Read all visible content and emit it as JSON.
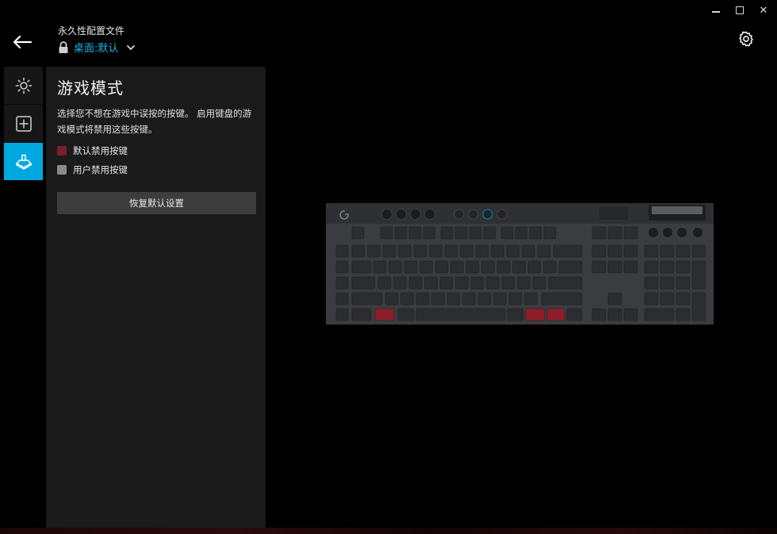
{
  "window": {
    "minimize_icon": "minimize-icon",
    "maximize_icon": "maximize-icon",
    "close_glyph": "✕"
  },
  "header": {
    "profile_label": "永久性配置文件",
    "profile_value": "桌面:默认",
    "back_icon": "arrow-left-icon",
    "settings_icon": "gear-icon"
  },
  "rail": {
    "items": [
      {
        "icon": "lighting-sun-icon",
        "active": false
      },
      {
        "icon": "add-assignment-icon",
        "active": false
      },
      {
        "icon": "game-mode-joystick-icon",
        "active": true
      }
    ]
  },
  "panel": {
    "title": "游戏模式",
    "description": "选择您不想在游戏中误按的按键。 启用键盘的游戏模式将禁用这些按键。",
    "legend": [
      {
        "label": "默认禁用按键",
        "color": "#7a1f2b"
      },
      {
        "label": "用户禁用按键",
        "color": "#8a8a8a"
      }
    ],
    "restore_button": "恢复默认设置"
  },
  "colors": {
    "accent": "#00a8e0",
    "profile_text": "#1ab0e8",
    "disabled_key": "#8c1f2a",
    "key": "#2c2d30",
    "keyboard_body": "#3a3c40"
  }
}
